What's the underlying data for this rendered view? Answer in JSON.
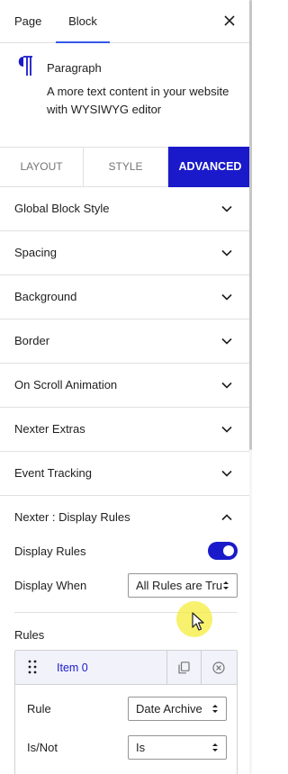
{
  "header": {
    "tabs": [
      {
        "label": "Page",
        "active": false
      },
      {
        "label": "Block",
        "active": true
      }
    ],
    "close_icon": "close-icon"
  },
  "block": {
    "icon": "paragraph-icon",
    "name": "Paragraph",
    "description": "A more text content in your website with WYSIWYG editor"
  },
  "settings_tabs": [
    {
      "label": "LAYOUT",
      "active": false
    },
    {
      "label": "STYLE",
      "active": false
    },
    {
      "label": "ADVANCED",
      "active": true
    }
  ],
  "panels": [
    {
      "label": "Global Block Style",
      "expanded": false
    },
    {
      "label": "Spacing",
      "expanded": false
    },
    {
      "label": "Background",
      "expanded": false
    },
    {
      "label": "Border",
      "expanded": false
    },
    {
      "label": "On Scroll Animation",
      "expanded": false
    },
    {
      "label": "Nexter Extras",
      "expanded": false
    },
    {
      "label": "Event Tracking",
      "expanded": false
    },
    {
      "label": "Nexter : Display Rules",
      "expanded": true
    }
  ],
  "display_rules": {
    "toggle_label": "Display Rules",
    "toggle_on": true,
    "display_when_label": "Display When",
    "display_when_value": "All Rules are True",
    "rules_label": "Rules",
    "items": [
      {
        "title": "Item 0",
        "rule_label": "Rule",
        "rule_value": "Date Archive",
        "isnot_label": "Is/Not",
        "isnot_value": "Is"
      }
    ]
  },
  "colors": {
    "accent": "#1a1aca",
    "wp_blue": "#3858e9",
    "border": "#e0e0e0",
    "cursor_highlight": "#f5ec3c"
  }
}
